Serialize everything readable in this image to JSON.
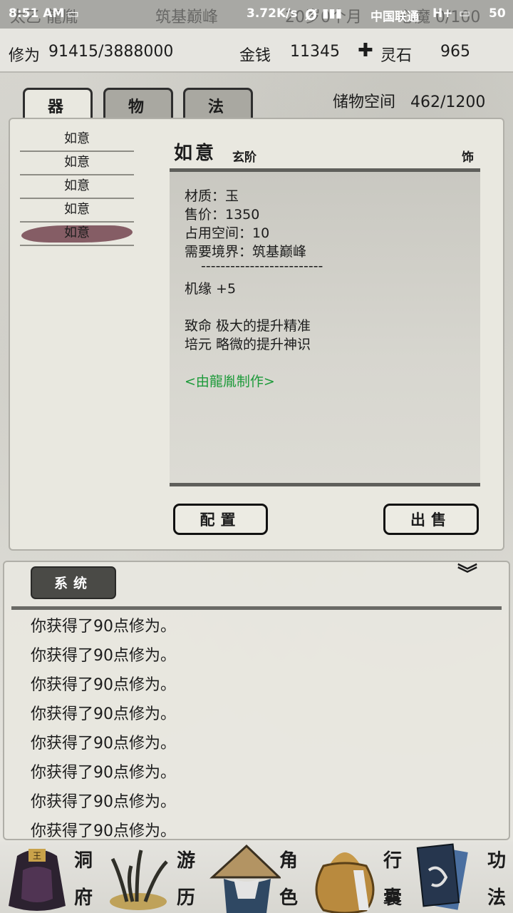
{
  "status_bar": {
    "time": "8:51 AM",
    "network_speed": "3.72K/s",
    "carrier": "中国联通",
    "network_type": "H+",
    "battery": "50",
    "obscured_behind": [
      "太乙 龍胤",
      "筑基巅峰",
      "20岁0个月",
      "心魔 0/100"
    ]
  },
  "stats": {
    "cultivation_label": "修为",
    "cultivation_value": "91415/3888000",
    "money_label": "金钱",
    "money_value": "11345",
    "spirit_stone_icon": "cross-icon",
    "spirit_stone_label": "灵石",
    "spirit_stone_value": "965"
  },
  "tabs": [
    {
      "label": "器",
      "active": true
    },
    {
      "label": "物",
      "active": false
    },
    {
      "label": "法",
      "active": false
    }
  ],
  "storage": {
    "label": "储物空间",
    "value": "462/1200"
  },
  "items": [
    "如意",
    "如意",
    "如意",
    "如意",
    "如意"
  ],
  "selected_item_index": 4,
  "detail": {
    "name": "如意",
    "rank": "玄阶",
    "type": "饰",
    "material": "材质：玉",
    "price": "售价：1350",
    "space": "占用空间：10",
    "realm": "需要境界：筑基巅峰",
    "separator": "-------------------------",
    "bonus": "机缘 +5",
    "effect1": "致命 极大的提升精准",
    "effect2": "培元 略微的提升神识",
    "maker": "<由龍胤制作>",
    "maker_color": "#1d9a3a"
  },
  "buttons": {
    "configure": "配置",
    "sell": "出售"
  },
  "log": {
    "tab_label": "系统",
    "lines": [
      "你获得了90点修为。",
      "你获得了90点修为。",
      "你获得了90点修为。",
      "你获得了90点修为。",
      "你获得了90点修为。",
      "你获得了90点修为。",
      "你获得了90点修为。",
      "你获得了90点修为。"
    ]
  },
  "nav": [
    {
      "top": "洞",
      "bottom": "府",
      "icon": "cave-bag-icon"
    },
    {
      "top": "游",
      "bottom": "历",
      "icon": "grass-icon"
    },
    {
      "top": "角",
      "bottom": "色",
      "icon": "straw-hat-icon"
    },
    {
      "top": "行",
      "bottom": "囊",
      "icon": "pouch-icon"
    },
    {
      "top": "功",
      "bottom": "法",
      "icon": "scroll-books-icon"
    }
  ]
}
